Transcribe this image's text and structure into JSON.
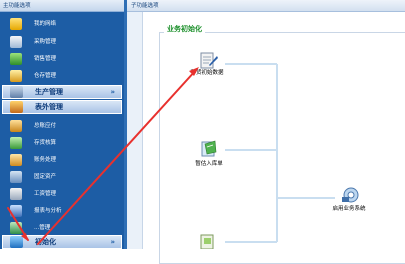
{
  "sidebar": {
    "title": "主功能选项",
    "items_top": [
      {
        "label": "我的网络",
        "icon": "network-folder-icon"
      },
      {
        "label": "采购管理",
        "icon": "purchase-icon"
      },
      {
        "label": "销售管理",
        "icon": "sales-icon"
      },
      {
        "label": "仓存管理",
        "icon": "warehouse-icon"
      }
    ],
    "section_production": "生产管理",
    "section_finance": "表外管理",
    "items_bottom": [
      {
        "label": "总账应付",
        "icon": "ledger-icon"
      },
      {
        "label": "存货核算",
        "icon": "inventory-calc-icon"
      },
      {
        "label": "账务处理",
        "icon": "accounting-icon"
      },
      {
        "label": "固定资产",
        "icon": "fixed-assets-icon"
      },
      {
        "label": "工资管理",
        "icon": "payroll-icon"
      },
      {
        "label": "报表与分析",
        "icon": "report-icon"
      },
      {
        "label": "...管理",
        "icon": "management-icon"
      }
    ],
    "active_item": "初始化",
    "chevron": "»"
  },
  "panel": {
    "title": "子功能选项",
    "group_title": "业务初始化",
    "nodes": {
      "inventory_init": "存货初始数据",
      "temp_voucher": "暂估入库单",
      "enable_system": "启用业务系统"
    }
  }
}
